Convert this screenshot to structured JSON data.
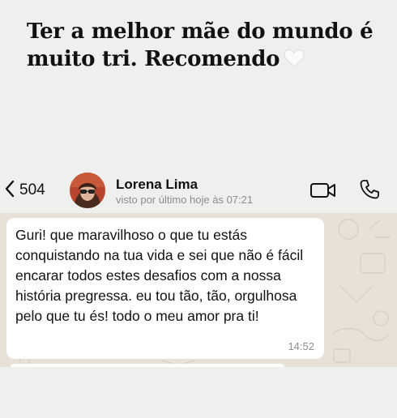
{
  "headline": {
    "text": "Ter a melhor mãe do mundo é muito tri. Recomendo",
    "emoji_icon": "white-heart-icon"
  },
  "chat_header": {
    "back_icon": "chevron-left-icon",
    "unread_count": "504",
    "contact_name": "Lorena Lima",
    "last_seen": "visto por último hoje às 07:21",
    "video_icon": "video-camera-icon",
    "call_icon": "phone-icon"
  },
  "message": {
    "text": "Guri! que maravilhoso o que tu estás conquistando na tua vida e sei que não é fácil encarar todos estes desafios com a nossa história pregressa. eu tou tão, tão, orgulhosa pelo que tu és! todo o meu amor pra ti!",
    "time": "14:52"
  },
  "colors": {
    "page_background": "#efefee",
    "chat_background": "#e7e1d7",
    "bubble": "#ffffff",
    "accent_text": "#111111",
    "muted_text": "#8c8c8c"
  }
}
